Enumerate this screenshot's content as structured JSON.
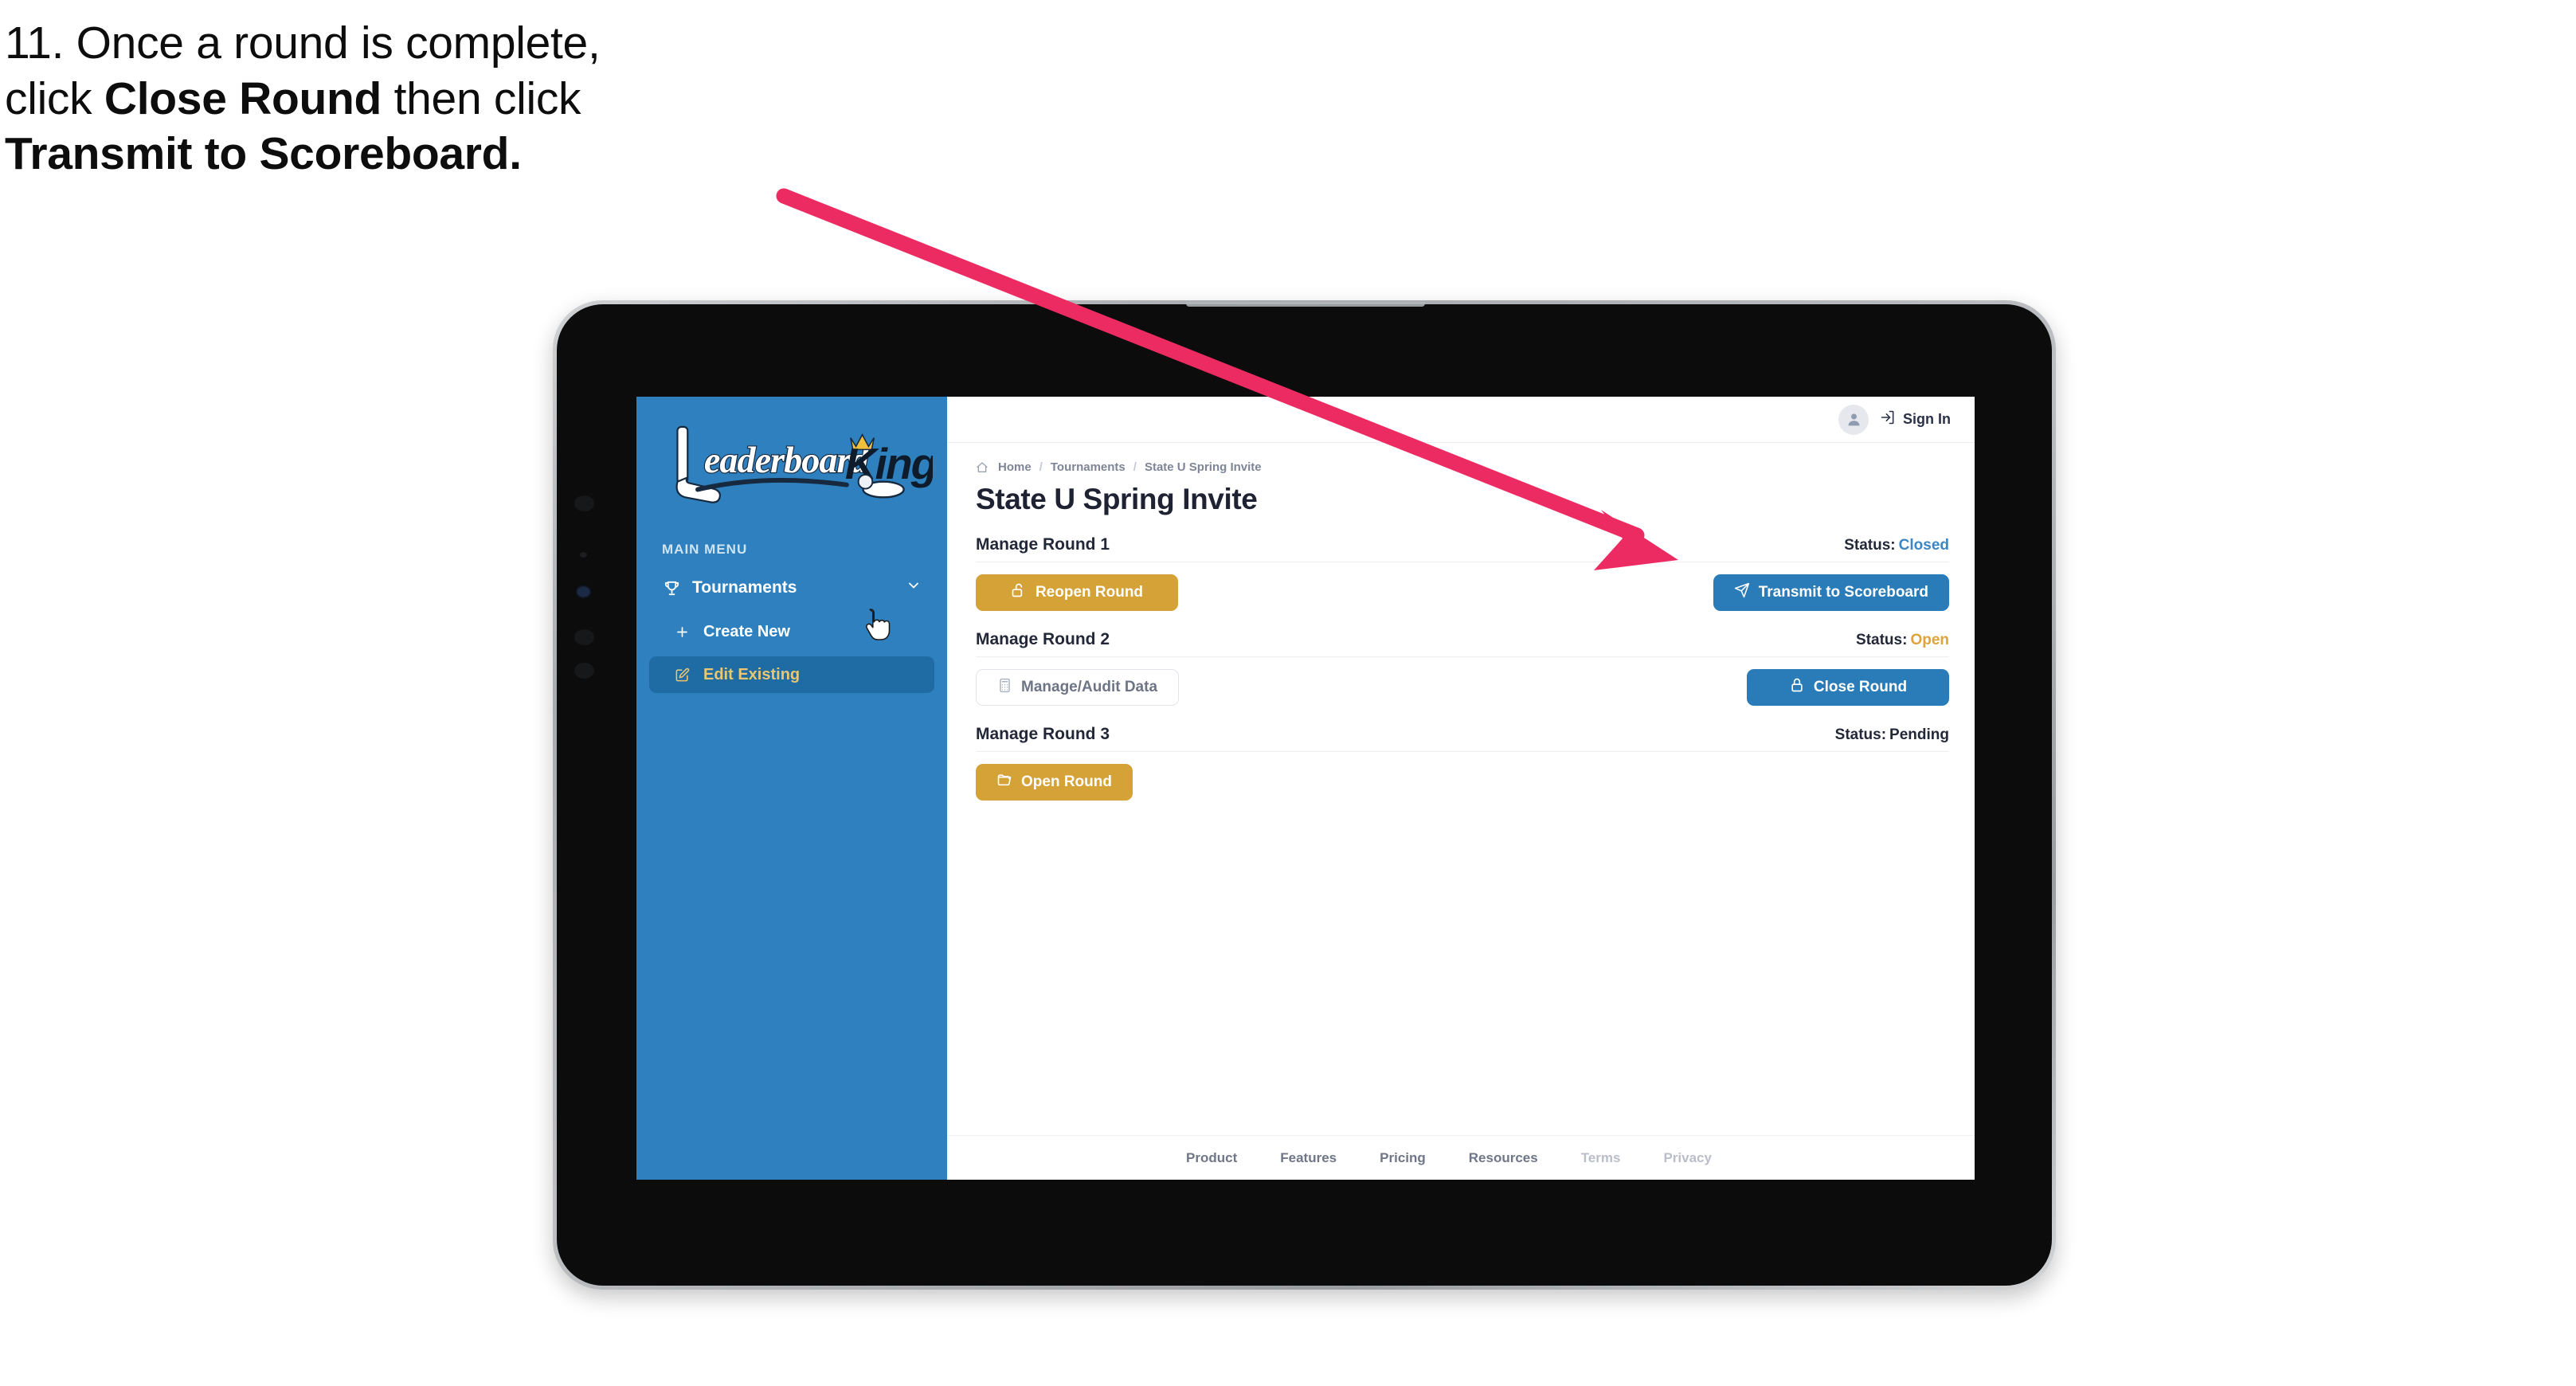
{
  "caption": {
    "line1": "11. Once a round is complete,",
    "line2_pre": "click ",
    "line2_strong": "Close Round",
    "line2_post": " then click",
    "line3_strong": "Transmit to Scoreboard."
  },
  "annotation": {
    "arrow_color": "#ec2b62",
    "points_at": "Transmit to Scoreboard"
  },
  "sidebar": {
    "logo": {
      "word1": "Leaderboard",
      "word2": "King"
    },
    "menu_label": "MAIN MENU",
    "items": [
      {
        "label": "Tournaments",
        "icon": "trophy-icon",
        "chevron": "chevron-down-icon",
        "active": false
      },
      {
        "label": "Create New",
        "icon": "plus-icon",
        "active": false
      },
      {
        "label": "Edit Existing",
        "icon": "edit-icon",
        "active": true
      }
    ]
  },
  "topbar": {
    "avatar_icon": "user-icon",
    "signin_icon": "sign-in-icon",
    "signin_label": "Sign In"
  },
  "breadcrumb": {
    "home_icon": "home-icon",
    "items": [
      "Home",
      "Tournaments",
      "State U Spring Invite"
    ],
    "separator": "/"
  },
  "page_title": "State U Spring Invite",
  "rounds": [
    {
      "title": "Manage Round 1",
      "status_label": "Status:",
      "status_value": "Closed",
      "status_color": "#3d86c6",
      "left_button": {
        "label": "Reopen Round",
        "icon": "unlock-icon",
        "style": "gold"
      },
      "right_button": {
        "label": "Transmit to Scoreboard",
        "icon": "paper-plane-icon",
        "style": "blue"
      }
    },
    {
      "title": "Manage Round 2",
      "status_label": "Status:",
      "status_value": "Open",
      "status_color": "#e0a33a",
      "left_button": {
        "label": "Manage/Audit Data",
        "icon": "calculator-icon",
        "style": "ghost"
      },
      "right_button": {
        "label": "Close Round",
        "icon": "lock-icon",
        "style": "blue"
      }
    },
    {
      "title": "Manage Round 3",
      "status_label": "Status:",
      "status_value": "Pending",
      "status_color": "#232838",
      "left_button": {
        "label": "Open Round",
        "icon": "folder-open-icon",
        "style": "gold"
      },
      "right_button": null
    }
  ],
  "footer": {
    "links": [
      {
        "label": "Product",
        "dim": false
      },
      {
        "label": "Features",
        "dim": false
      },
      {
        "label": "Pricing",
        "dim": false
      },
      {
        "label": "Resources",
        "dim": false
      },
      {
        "label": "Terms",
        "dim": true
      },
      {
        "label": "Privacy",
        "dim": true
      }
    ]
  },
  "colors": {
    "sidebar_blue": "#2e80be",
    "sidebar_active": "#1f6ba3",
    "accent_gold": "#d4a236",
    "accent_blue": "#2a7cb8",
    "active_text_gold": "#e9c772"
  }
}
